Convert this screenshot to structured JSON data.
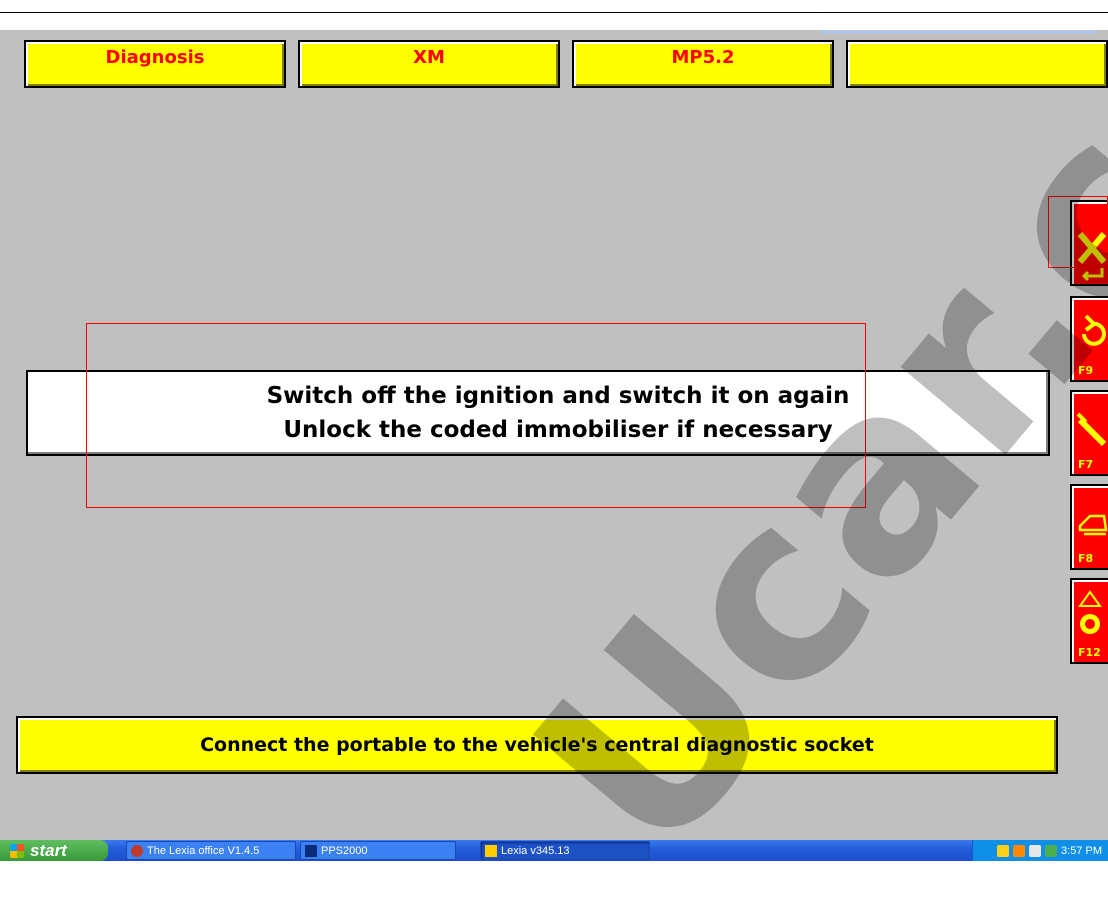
{
  "header": {
    "tabs": [
      {
        "label": "Diagnosis"
      },
      {
        "label": "XM"
      },
      {
        "label": "MP5.2"
      },
      {
        "label": ""
      }
    ]
  },
  "sidebar": {
    "buttons": [
      {
        "icon": "cancel-enter-icon",
        "key": ""
      },
      {
        "icon": "undo-icon",
        "key": "F9"
      },
      {
        "icon": "tool-icon",
        "key": "F7"
      },
      {
        "icon": "printer-icon",
        "key": "F8"
      },
      {
        "icon": "globe-icon",
        "key": "F12"
      }
    ]
  },
  "message": {
    "line1": "Switch off the ignition and switch it on again",
    "line2": "Unlock the coded immobiliser if necessary"
  },
  "status": {
    "text": "Connect the portable to the vehicle's central diagnostic socket"
  },
  "watermark": "Ucar.co",
  "taskbar": {
    "start_label": "start",
    "tasks": [
      {
        "label": "The Lexia office V1.4.5"
      },
      {
        "label": "PPS2000"
      },
      {
        "label": "Lexia v345.13"
      }
    ],
    "clock": "3:57 PM"
  },
  "colors": {
    "button_yellow": "#ffff00",
    "label_red": "#ff0000",
    "panel_grey": "#c0c0c0"
  }
}
